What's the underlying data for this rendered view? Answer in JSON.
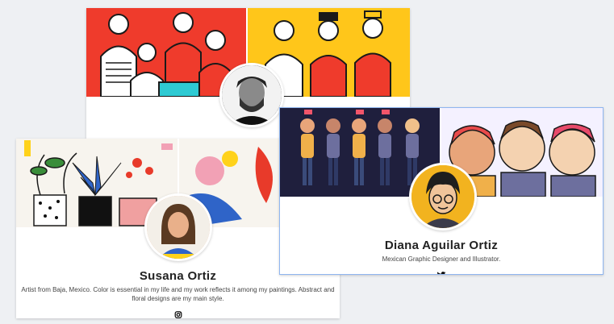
{
  "cards": [
    {
      "id": "back-card",
      "colors": {
        "banner_left": "#ef3b2c",
        "banner_right": "#ffc61a",
        "avatar_bg": "#1e1e1e"
      }
    },
    {
      "id": "susana",
      "name": "Susana Ortiz",
      "bio": "Artist from Baja, Mexico. Color is essential in my life and my work reflects it among my paintings. Abstract and floral designs are my main style.",
      "social_icon": "instagram-icon",
      "colors": {
        "banner": "#f7f4ee",
        "accent_blue": "#2f64c8",
        "accent_pink": "#f2a1b5",
        "avatar_bg": "#e9b08a"
      }
    },
    {
      "id": "diana",
      "name": "Diana Aguilar Ortiz",
      "bio": "Mexican Graphic Designer and Illustrator.",
      "social_icon": "twitter-icon",
      "colors": {
        "banner_left": "#1f1f3d",
        "banner_right": "#f4f1ff",
        "avatar_bg": "#f2b31f",
        "border": "#8fb6f0"
      }
    }
  ]
}
